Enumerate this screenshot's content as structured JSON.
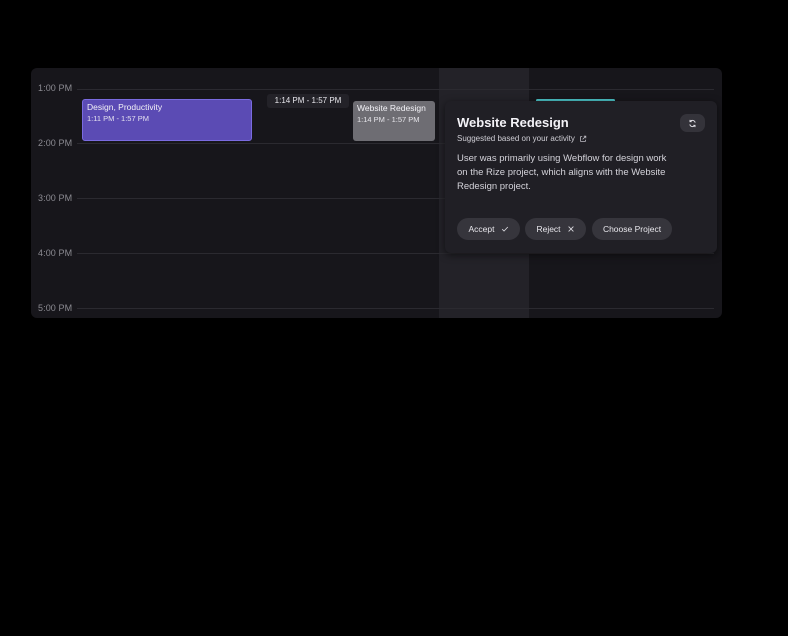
{
  "calendar": {
    "hours": [
      "1:00 PM",
      "2:00 PM",
      "3:00 PM",
      "4:00 PM",
      "5:00 PM"
    ],
    "events": [
      {
        "title": "Design, Productivity",
        "time": "1:11 PM - 1:57 PM",
        "color": "#5b4bb4"
      },
      {
        "title": "Website Redesign",
        "time": "1:14 PM - 1:57 PM",
        "color": "#6e6d73"
      }
    ],
    "hover_time": "1:14 PM - 1:57 PM",
    "accent_teal": "#4bc2c6"
  },
  "suggestion": {
    "title": "Website Redesign",
    "subtitle": "Suggested based on your activity",
    "description": "User was primarily using Webflow for design work on the Rize project, which aligns with the Website Redesign project.",
    "accept_label": "Accept",
    "reject_label": "Reject",
    "choose_label": "Choose Project",
    "icons": {
      "refresh": "refresh-icon",
      "external": "external-link-icon",
      "accept": "check-icon",
      "reject": "close-icon"
    }
  }
}
